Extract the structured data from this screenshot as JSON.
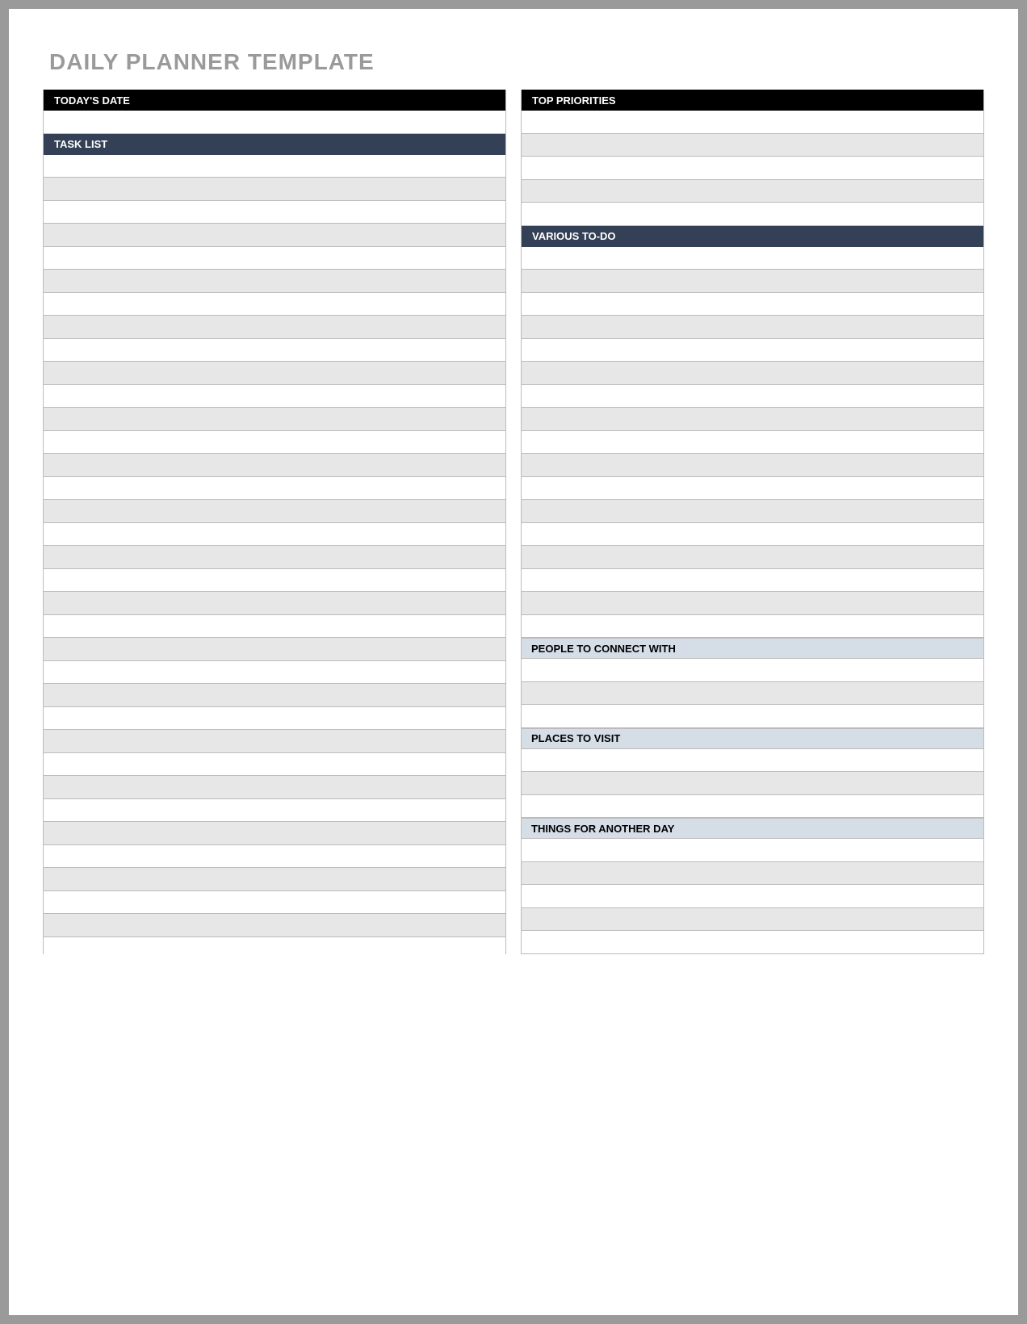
{
  "title": "DAILY PLANNER TEMPLATE",
  "left": {
    "date_header": "TODAY'S DATE",
    "tasklist_header": "TASK LIST"
  },
  "right": {
    "priorities_header": "TOP PRIORITIES",
    "todo_header": "VARIOUS TO-DO",
    "people_header": "PEOPLE TO CONNECT WITH",
    "places_header": "PLACES TO VISIT",
    "another_header": "THINGS FOR ANOTHER DAY"
  },
  "row_counts": {
    "date_rows": 1,
    "tasklist_rows": 34,
    "priorities_rows": 5,
    "todo_rows": 17,
    "people_rows": 3,
    "places_rows": 3,
    "another_rows": 5
  }
}
